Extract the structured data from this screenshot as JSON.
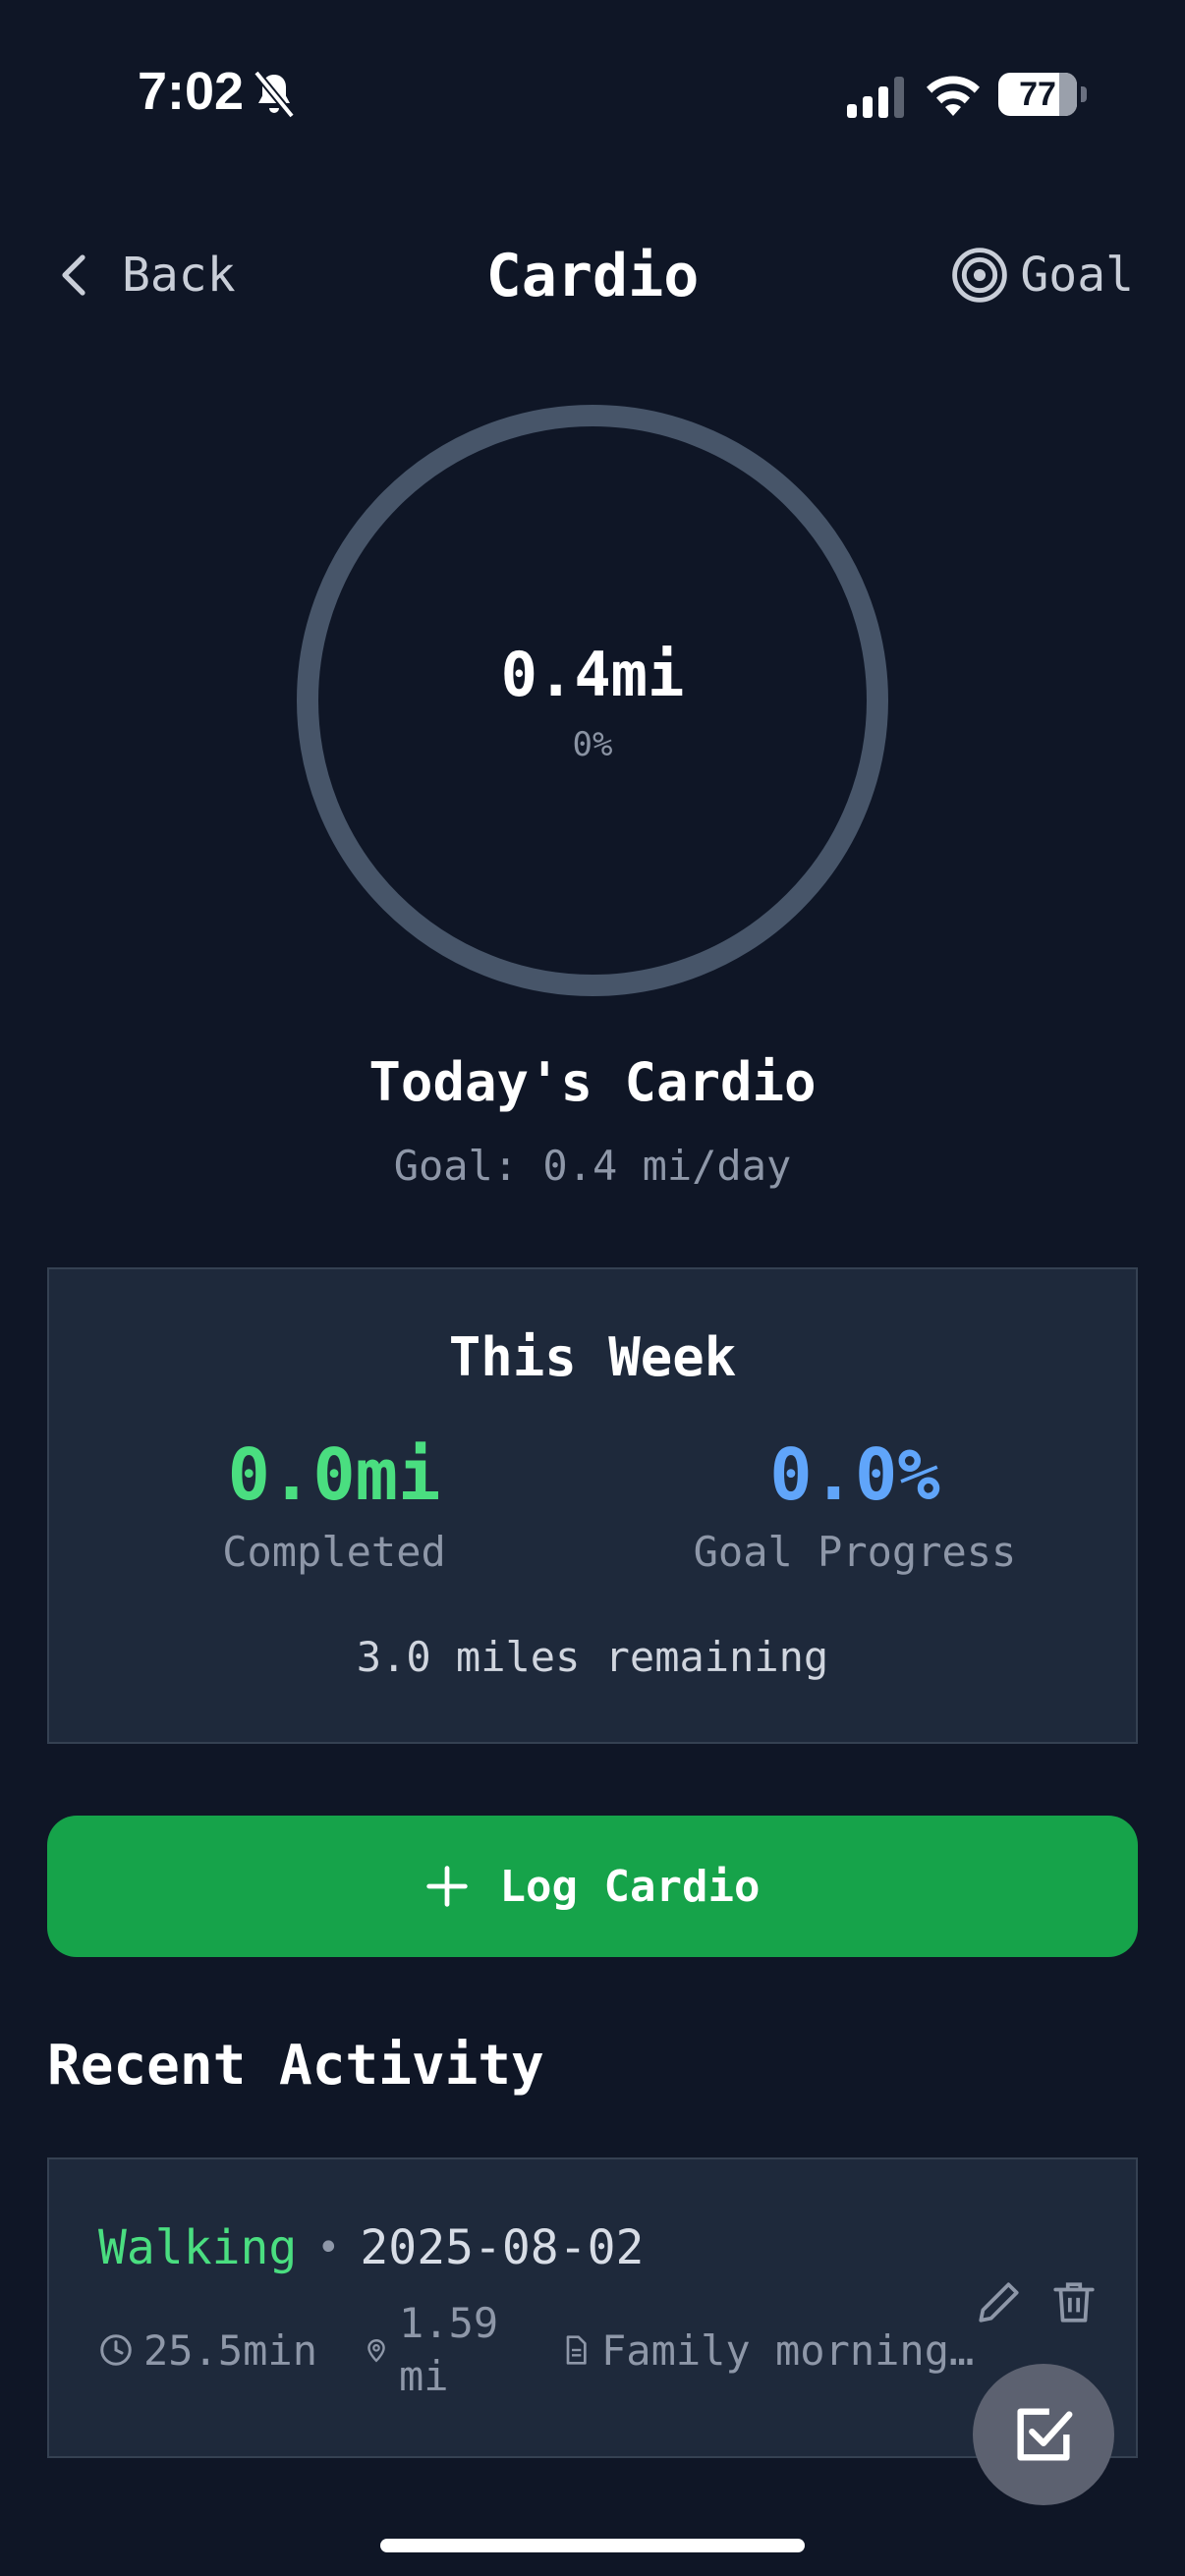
{
  "status_bar": {
    "time": "7:02",
    "battery": "77"
  },
  "header": {
    "back_label": "Back",
    "title": "Cardio",
    "goal_label": "Goal"
  },
  "ring": {
    "value": "0.4mi",
    "percent_label": "0%",
    "progress_fraction": 0.0
  },
  "today": {
    "title": "Today's Cardio",
    "goal": "Goal: 0.4 mi/day"
  },
  "week": {
    "title": "This Week",
    "completed_value": "0.0mi",
    "completed_label": "Completed",
    "progress_value": "0.0%",
    "progress_label": "Goal Progress",
    "remaining": "3.0 miles remaining"
  },
  "log_button": {
    "label": "Log Cardio"
  },
  "recent": {
    "title": "Recent Activity",
    "items": [
      {
        "type": "Walking",
        "separator": "•",
        "date": "2025-08-02",
        "duration": "25.5min",
        "distance": "1.59 mi",
        "note": "Family morning…"
      }
    ]
  },
  "colors": {
    "background": "#0f1626",
    "card": "#1e293b",
    "accent_green": "#16a34a",
    "green_text": "#4ade80",
    "blue_text": "#60a5fa",
    "ring_track": "#475569"
  },
  "icons": {
    "bell": "bell-slash-icon",
    "back": "chevron-left-icon",
    "goal": "target-icon",
    "add": "plus-icon",
    "clock": "clock-icon",
    "pin": "map-pin-icon",
    "note": "file-text-icon",
    "edit": "pencil-icon",
    "delete": "trash-icon",
    "fab": "checkbox-icon"
  }
}
